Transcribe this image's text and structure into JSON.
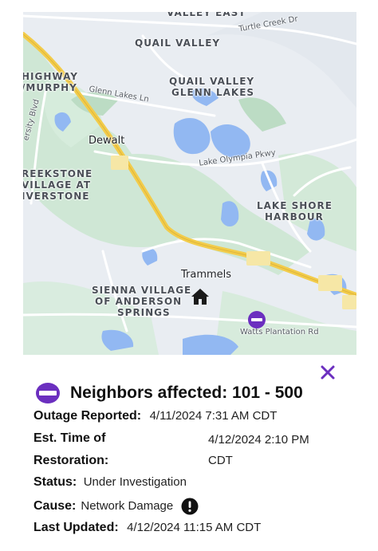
{
  "map": {
    "areas": {
      "valley_east": "VALLEY EAST",
      "quail_valley": "QUAIL VALLEY",
      "quail_valley_glenn_1": "QUAIL VALLEY",
      "quail_valley_glenn_2": "GLENN LAKES",
      "highway_murphy_1": "HIGHWAY",
      "highway_murphy_2": "/MURPHY",
      "creekstone_1": "REEKSTONE",
      "creekstone_2": "VILLAGE AT",
      "creekstone_3": "IVERSTONE",
      "lake_shore_1": "LAKE SHORE",
      "lake_shore_2": "HARBOUR",
      "sienna_1": "SIENNA VILLAGE",
      "sienna_2": "OF ANDERSON",
      "sienna_3": "SPRINGS"
    },
    "roads": {
      "turtle_creek": "Turtle Creek Dr",
      "glenn_lakes": "Glenn Lakes Ln",
      "lake_olympia": "Lake Olympia Pkwy",
      "university": "ersity Blvd",
      "watts": "Watts Plantation Rd"
    },
    "places": {
      "dewalt": "Dewalt",
      "trammels": "Trammels"
    },
    "icons": {
      "home": "home-icon",
      "outage": "outage-marker-icon"
    },
    "colors": {
      "water": "#92b8f2",
      "green": "#cfe7d5",
      "highway": "#f2cc4b",
      "accent": "#6b2fbf"
    }
  },
  "panel": {
    "title": "Neighbors affected: 101 - 500",
    "outage_reported_label": "Outage Reported:",
    "outage_reported_value": "4/11/2024 7:31 AM CDT",
    "etr_label_1": "Est. Time of",
    "etr_label_2": "Restoration:",
    "etr_value_1": "4/12/2024 2:10 PM",
    "etr_value_2": "CDT",
    "status_label": "Status:",
    "status_value": "Under Investigation",
    "cause_label": "Cause:",
    "cause_value": "Network Damage",
    "last_updated_label": "Last Updated:",
    "last_updated_value": "4/12/2024 11:15 AM CDT",
    "icons": {
      "outage": "outage-marker-icon",
      "close": "close-icon",
      "info": "alert-icon"
    }
  }
}
